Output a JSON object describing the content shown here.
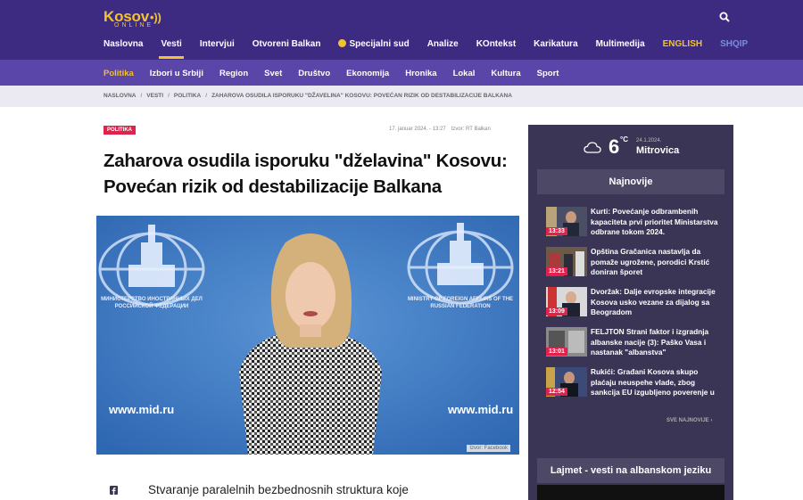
{
  "header": {
    "logo_main": "Kosov",
    "logo_sub": "ONLINE",
    "nav": [
      {
        "label": "Naslovna"
      },
      {
        "label": "Vesti"
      },
      {
        "label": "Intervjui"
      },
      {
        "label": "Otvoreni Balkan"
      },
      {
        "label": "Specijalni sud"
      },
      {
        "label": "Analize"
      },
      {
        "label": "KOntekst"
      },
      {
        "label": "Karikatura"
      },
      {
        "label": "Multimedija"
      },
      {
        "label": "ENGLISH"
      },
      {
        "label": "SHQIP"
      }
    ],
    "active_nav": "Vesti",
    "accent_color": "#f2c230",
    "bar_color": "#3d2b82"
  },
  "subnav": {
    "items": [
      {
        "label": "Politika"
      },
      {
        "label": "Izbori u Srbiji"
      },
      {
        "label": "Region"
      },
      {
        "label": "Svet"
      },
      {
        "label": "Društvo"
      },
      {
        "label": "Ekonomija"
      },
      {
        "label": "Hronika"
      },
      {
        "label": "Lokal"
      },
      {
        "label": "Kultura"
      },
      {
        "label": "Sport"
      }
    ],
    "active": "Politika"
  },
  "breadcrumb": [
    "NASLOVNA",
    "VESTI",
    "POLITIKA",
    "ZAHAROVA OSUDILA ISPORUKU \"DŽAVELINA\" KOSOVU: POVEĆAN RIZIK OD DESTABILIZACIJE BALKANA"
  ],
  "article": {
    "category": "POLITIKA",
    "date": "17. januar 2024. - 13:27",
    "source": "Izvor: RT Balkan",
    "title": "Zaharova osudila isporuku \"dželavina\" Kosovu: Povećan rizik od destabilizacije Balkana",
    "photo_credit": "Izvor: Facebook",
    "photo_text_left": "www.mid.ru",
    "photo_text_right": "www.mid.ru",
    "photo_ministry_ru": "МИНИСТЕРСТВО ИНОСТРАННЫХ ДЕЛ РОССИЙСКОЙ ФЕДЕРАЦИИ",
    "photo_ministry_en": "MINISTRY OF FOREIGN AFFAIRS OF THE RUSSIAN FEDERATION",
    "teaser": "Stvaranje paralelnih bezbednosnih struktura koje"
  },
  "weather": {
    "temp": "6",
    "unit": "°C",
    "date": "24.1.2024.",
    "city": "Mitrovica",
    "icon": "cloud-icon"
  },
  "sidebar": {
    "latest_title": "Najnovije",
    "news": [
      {
        "time": "13:33",
        "text": "Kurti: Povećanje odbrambenih kapaciteta prvi prioritet Ministarstva odbrane tokom 2024."
      },
      {
        "time": "13:21",
        "text": "Opština Gračanica nastavlja da pomaže ugrožene, porodici Krstić doniran šporet"
      },
      {
        "time": "13:09",
        "text": "Dvoržak: Dalje evropske integracije Kosova usko vezane za dijalog sa Beogradom"
      },
      {
        "time": "13:01",
        "text": "FELJTON Strani faktor i izgradnja albanske nacije (3): Paško Vasa i nastanak \"albanstva\""
      },
      {
        "time": "12:54",
        "text": "Rukići: Građani Kosova skupo plaćaju neuspehe vlade, zbog sankcija EU izgubljeno poverenje u"
      }
    ],
    "more_label": "SVE NAJNOVIJE ›",
    "albanian_title": "Lajmet - vesti na albanskom jeziku"
  }
}
